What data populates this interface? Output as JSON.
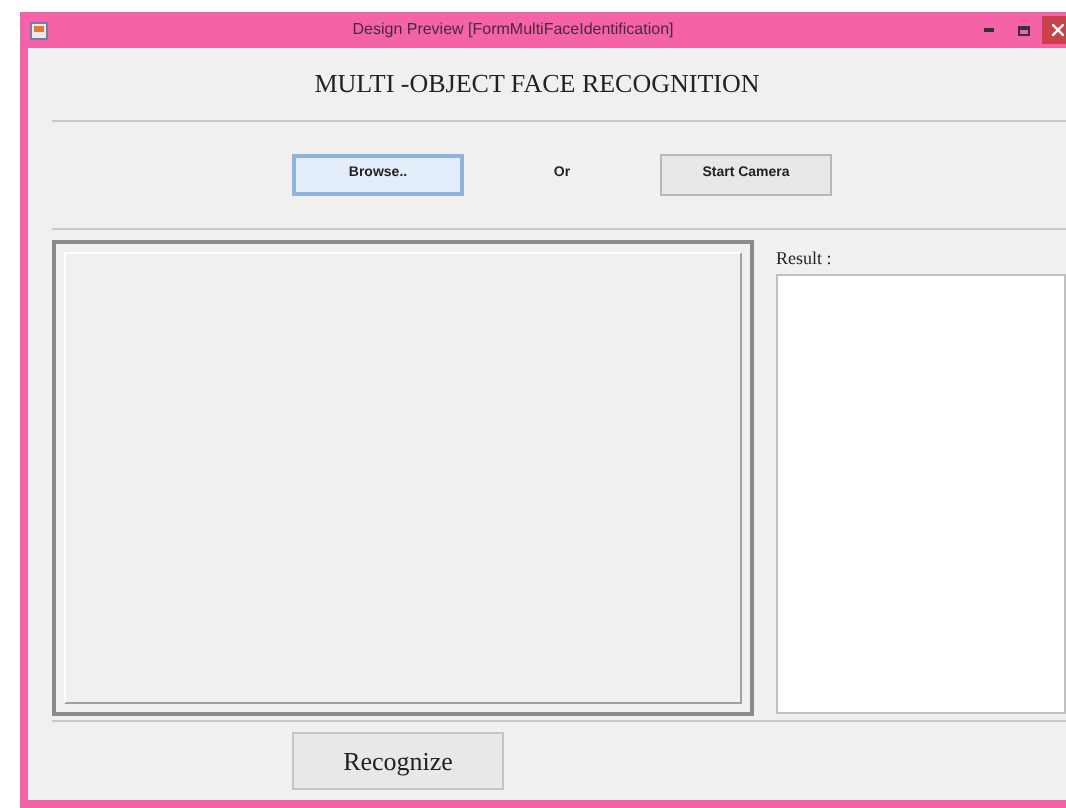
{
  "window": {
    "title": "Design Preview [FormMultiFaceIdentification]"
  },
  "heading": "MULTI -OBJECT FACE RECOGNITION",
  "buttons": [
    {
      "kind": "button",
      "label": "Browse..",
      "focused": true
    },
    {
      "kind": "text",
      "label": "Or"
    },
    {
      "kind": "button",
      "label": "Start Camera",
      "focused": false
    }
  ],
  "result": {
    "label": "Result :"
  },
  "recognize_button": {
    "label": "Recognize"
  }
}
